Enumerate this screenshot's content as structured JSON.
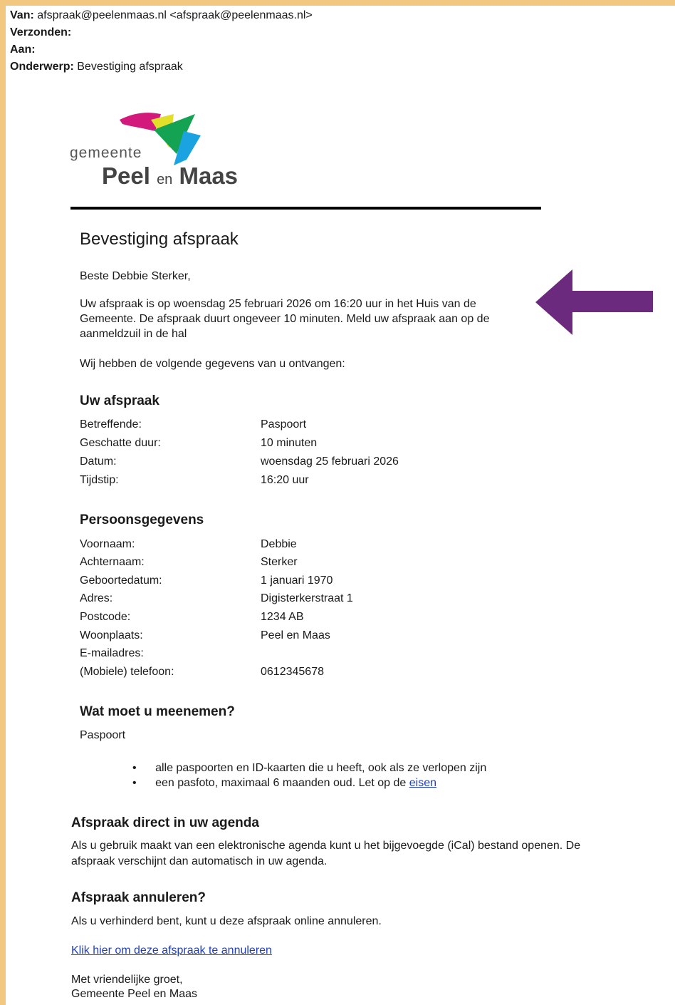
{
  "header": {
    "from_label": "Van:",
    "from_value": "afspraak@peelenmaas.nl <afspraak@peelenmaas.nl>",
    "sent_label": "Verzonden:",
    "to_label": "Aan:",
    "subject_label": "Onderwerp:",
    "subject_value": "Bevestiging afspraak"
  },
  "logo": {
    "word1": "gemeente",
    "word2a": "Peel",
    "word2b": "en",
    "word2c": "Maas"
  },
  "title": "Bevestiging afspraak",
  "greeting": "Beste Debbie Sterker,",
  "intro_lines": [
    "Uw afspraak is op woensdag 25 februari 2026 om 16:20 uur in het Huis van de",
    "Gemeente. De afspraak duurt ongeveer 10 minuten. Meld uw afspraak aan op de",
    "aanmeldzuil in de hal"
  ],
  "received": "Wij hebben de volgende gegevens van u ontvangen:",
  "appointment": {
    "heading": "Uw afspraak",
    "rows": [
      {
        "label": "Betreffende:",
        "value": "Paspoort"
      },
      {
        "label": "Geschatte duur:",
        "value": "10 minuten"
      },
      {
        "label": "Datum:",
        "value": "woensdag 25 februari 2026"
      },
      {
        "label": "Tijdstip:",
        "value": "16:20 uur"
      }
    ]
  },
  "personal": {
    "heading": "Persoonsgegevens",
    "rows": [
      {
        "label": "Voornaam:",
        "value": "Debbie"
      },
      {
        "label": "Achternaam:",
        "value": "Sterker"
      },
      {
        "label": "Geboortedatum:",
        "value": "1 januari 1970"
      },
      {
        "label": "Adres:",
        "value": "Digisterkerstraat 1"
      },
      {
        "label": "Postcode:",
        "value": "1234 AB"
      },
      {
        "label": "Woonplaats:",
        "value": "Peel en Maas"
      },
      {
        "label": "E-mailadres:",
        "value": ""
      },
      {
        "label": "(Mobiele) telefoon:",
        "value": "0612345678"
      }
    ]
  },
  "bring": {
    "heading": "Wat moet u meenemen?",
    "item": "Paspoort",
    "bullet1": "alle paspoorten en ID-kaarten die u heeft, ook als ze verlopen zijn",
    "bullet2": "een pasfoto, maximaal 6 maanden oud. Let op de",
    "bullet2_link": "eisen"
  },
  "agenda": {
    "heading": "Afspraak direct in uw agenda",
    "line1": "Als u gebruik maakt van een elektronische agenda kunt u het bijgevoegde (iCal) bestand openen. De",
    "line2": "afspraak verschijnt dan automatisch in uw agenda."
  },
  "cancel": {
    "heading": "Afspraak annuleren?",
    "text": "Als u verhinderd bent, kunt u deze afspraak online annuleren.",
    "link": "Klik hier om deze afspraak te annuleren"
  },
  "closing": {
    "line1": "Met vriendelijke groet,",
    "line2": "Gemeente Peel en Maas"
  },
  "colors": {
    "frame": "#f2c77f",
    "arrow": "#6b2a7e",
    "link": "#1f3fbf"
  }
}
